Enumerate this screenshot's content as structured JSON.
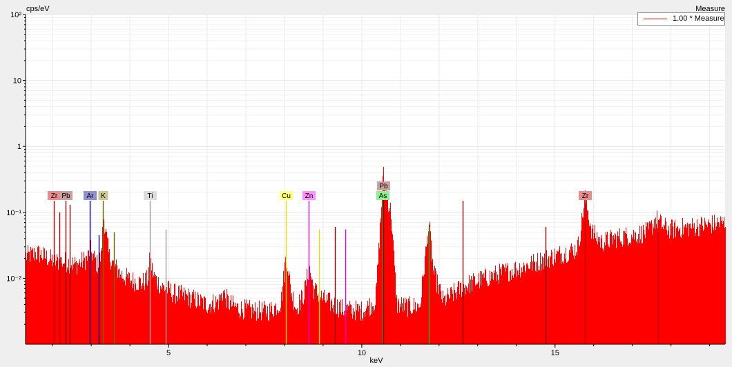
{
  "chart_data": {
    "type": "area",
    "title": "",
    "xlabel": "keV",
    "ylabel": "cps/eV",
    "xlim": [
      1.3,
      19.4
    ],
    "ylim": [
      0.001,
      100
    ],
    "yscale": "log",
    "grid": true,
    "legend_placement": "top-right",
    "x_ticks": [
      5,
      10,
      15
    ],
    "x_tick_labels": [
      "5",
      "10",
      "15"
    ],
    "y_ticks": [
      0.01,
      0.1,
      1,
      10,
      100
    ],
    "y_tick_labels": [
      "10⁻²",
      "10⁻¹",
      "1",
      "10",
      "10²"
    ],
    "colors": {
      "spectrum": "#ff0000",
      "background": "#ffffff",
      "grid": "#e6e6e6"
    },
    "series": [
      {
        "name": "1.00 * Measure",
        "color": "#d00000",
        "x": [
          1.35,
          1.6,
          1.9,
          2.04,
          2.3,
          2.6,
          2.9,
          2.96,
          3.05,
          3.15,
          3.25,
          3.31,
          3.45,
          3.6,
          3.8,
          4.0,
          4.3,
          4.45,
          4.51,
          4.6,
          4.8,
          4.93,
          5.1,
          5.5,
          6.0,
          6.3,
          6.4,
          6.55,
          6.8,
          7.2,
          7.6,
          7.9,
          8.0,
          8.04,
          8.15,
          8.3,
          8.5,
          8.63,
          8.75,
          9.0,
          9.5,
          10.0,
          10.35,
          10.5,
          10.55,
          10.62,
          10.75,
          10.9,
          11.2,
          11.5,
          11.73,
          11.85,
          12.1,
          12.61,
          13.0,
          13.5,
          14.0,
          14.5,
          15.0,
          15.5,
          15.6,
          15.77,
          15.95,
          16.2,
          16.5,
          17.0,
          17.4,
          17.6,
          17.8,
          18.0,
          18.5,
          19.0,
          19.4
        ],
        "y": [
          0.022,
          0.024,
          0.02,
          0.018,
          0.018,
          0.016,
          0.02,
          0.028,
          0.021,
          0.016,
          0.022,
          0.09,
          0.022,
          0.015,
          0.011,
          0.0095,
          0.0085,
          0.0095,
          0.02,
          0.011,
          0.0075,
          0.007,
          0.006,
          0.0052,
          0.004,
          0.0045,
          0.0062,
          0.0042,
          0.0035,
          0.0032,
          0.0032,
          0.0042,
          0.015,
          0.024,
          0.0068,
          0.0035,
          0.0058,
          0.015,
          0.0068,
          0.0048,
          0.0034,
          0.0032,
          0.0045,
          0.12,
          0.38,
          0.2,
          0.1,
          0.004,
          0.0037,
          0.0038,
          0.07,
          0.012,
          0.0045,
          0.0075,
          0.0092,
          0.0115,
          0.014,
          0.0175,
          0.022,
          0.027,
          0.032,
          0.17,
          0.05,
          0.035,
          0.04,
          0.045,
          0.05,
          0.08,
          0.06,
          0.055,
          0.06,
          0.065,
          0.07
        ]
      }
    ],
    "element_lines": [
      {
        "label": "Zr",
        "x": 2.04,
        "height": 0.15,
        "color": "#e88c8c",
        "line": "#c00000",
        "labeled": true
      },
      {
        "label": "Pb",
        "x": 2.34,
        "height": 0.15,
        "color": "#c8a0a0",
        "line": "#8b0000",
        "labeled": true
      },
      {
        "label": "Ar",
        "x": 2.96,
        "height": 0.15,
        "color": "#9090d0",
        "line": "#00008b",
        "labeled": true
      },
      {
        "label": "K",
        "x": 3.31,
        "height": 0.15,
        "color": "#c8c890",
        "line": "#6b6b00",
        "labeled": true
      },
      {
        "label": "Ti",
        "x": 4.51,
        "height": 0.15,
        "color": "#dcdcdc",
        "line": "#a0a0a0",
        "labeled": true
      },
      {
        "label": "Cu",
        "x": 8.04,
        "height": 0.15,
        "color": "#ffff80",
        "line": "#e0e000",
        "labeled": true
      },
      {
        "label": "Zn",
        "x": 8.63,
        "height": 0.15,
        "color": "#ff90ff",
        "line": "#e000e0",
        "labeled": true
      },
      {
        "label": "As",
        "x": 10.53,
        "height": 0.15,
        "color": "#90ee90",
        "line": "#20b020",
        "labeled": true
      },
      {
        "label": "Pb",
        "x": 10.55,
        "height": 0.2,
        "color": "#c8a0a0",
        "line": "#8b0000",
        "labeled": true
      },
      {
        "label": "Zr",
        "x": 15.77,
        "height": 0.15,
        "color": "#e88c8c",
        "line": "#c00000",
        "labeled": true
      },
      {
        "label": "",
        "x": 2.18,
        "height": 0.1,
        "color": "",
        "line": "#c00000",
        "labeled": false
      },
      {
        "label": "",
        "x": 2.44,
        "height": 0.13,
        "color": "",
        "line": "#8b0000",
        "labeled": false
      },
      {
        "label": "",
        "x": 3.19,
        "height": 0.045,
        "color": "",
        "line": "#00008b",
        "labeled": false
      },
      {
        "label": "",
        "x": 3.59,
        "height": 0.05,
        "color": "",
        "line": "#6b6b00",
        "labeled": false
      },
      {
        "label": "",
        "x": 4.93,
        "height": 0.055,
        "color": "",
        "line": "#a0a0a0",
        "labeled": false
      },
      {
        "label": "",
        "x": 8.9,
        "height": 0.055,
        "color": "",
        "line": "#e0e000",
        "labeled": false
      },
      {
        "label": "",
        "x": 9.57,
        "height": 0.055,
        "color": "",
        "line": "#e000e0",
        "labeled": false
      },
      {
        "label": "",
        "x": 9.3,
        "height": 0.06,
        "color": "",
        "line": "#8b0000",
        "labeled": false
      },
      {
        "label": "",
        "x": 11.73,
        "height": 0.06,
        "color": "",
        "line": "#20b020",
        "labeled": false
      },
      {
        "label": "",
        "x": 12.61,
        "height": 0.15,
        "color": "",
        "line": "#8b0000",
        "labeled": false
      },
      {
        "label": "",
        "x": 14.76,
        "height": 0.06,
        "color": "",
        "line": "#8b0000",
        "labeled": false
      },
      {
        "label": "",
        "x": 17.67,
        "height": 0.05,
        "color": "",
        "line": "#c00000",
        "labeled": false
      }
    ]
  },
  "legend": {
    "title": "Measure",
    "entry": "1.00 * Measure"
  }
}
